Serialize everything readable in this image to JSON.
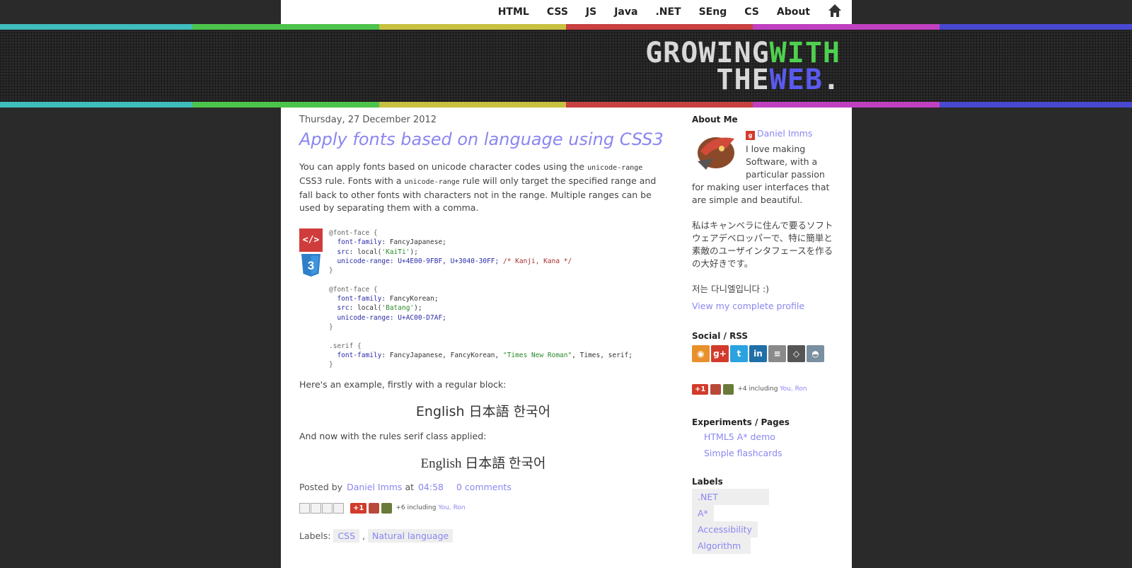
{
  "nav": {
    "items": [
      "HTML",
      "CSS",
      "JS",
      "Java",
      ".NET",
      "SEng",
      "CS",
      "About"
    ],
    "home_icon": "home-icon"
  },
  "stripe_colors": [
    "#3fbcbc",
    "#4cc44c",
    "#c8c040",
    "#c84040",
    "#c040c0",
    "#4848d0"
  ],
  "logo": {
    "line1": [
      "GROWING",
      "WITH"
    ],
    "line2": [
      "THE",
      "WEB",
      "."
    ]
  },
  "post": {
    "date": "Thursday, 27 December 2012",
    "title": "Apply fonts based on language using CSS3",
    "intro_1": "You can apply fonts based on unicode character codes using the ",
    "intro_code_1": "unicode-range",
    "intro_2": " CSS3 rule. Fonts with a ",
    "intro_code_2": "unicode-range",
    "intro_3": " rule will only target the specified range and fall back to other fonts with characters not in the range. Multiple ranges can be used by separating them with a comma.",
    "html_badge": "</>",
    "example_intro_1": "Here's an example, firstly with a regular block:",
    "example_text": "English 日本語 한국어",
    "example_intro_2": "And now with the rules serif class applied:",
    "posted_by_label": "Posted by",
    "author": "Daniel Imms",
    "at": "at",
    "time": "04:58",
    "comments": "0 comments",
    "plus_one": "+1",
    "plus_note_prefix": "+6 including ",
    "plus_note_names": "You, Ron",
    "labels_label": "Labels:",
    "labels": [
      "CSS",
      "Natural language"
    ]
  },
  "code": {
    "block1": [
      "@font-face {",
      "font-family",
      ": FancyJapanese;",
      "src",
      ": local(",
      "'KaiTi'",
      ");",
      "unicode-range",
      ": U+4E00-9FBF, U+3040-30FF;",
      "/* Kanji, Kana */",
      "}"
    ],
    "block2": [
      "@font-face {",
      "font-family",
      ": FancyKorean;",
      "src",
      ": local(",
      "'Batang'",
      ");",
      "unicode-range",
      ": U+AC00-D7AF;",
      "}"
    ],
    "block3": [
      ".serif {",
      "font-family",
      ": FancyJapanese, FancyKorean, ",
      "\"Times New Roman\"",
      ", Times, serif;",
      "}"
    ]
  },
  "sidebar": {
    "about_heading": "About Me",
    "author_link": "Daniel Imms",
    "about_text": "I love making Software, with a particular passion for making user interfaces that are simple and beautiful.",
    "japanese": "私はキャンベラに住んで要るソフトウェアデベロッパーで、特に簡単と素敵のユーザインタフェースを作るの大好きです。",
    "korean": "저는 다니엘입니다 :)",
    "profile_link": "View my complete profile",
    "social_heading": "Social / RSS",
    "social_icons": [
      {
        "name": "rss-icon",
        "glyph": "◉",
        "color": "#e8912c"
      },
      {
        "name": "google-plus-icon",
        "glyph": "g+",
        "color": "#d23b2c"
      },
      {
        "name": "twitter-icon",
        "glyph": "t",
        "color": "#2aa3e0"
      },
      {
        "name": "linkedin-icon",
        "glyph": "in",
        "color": "#1f6fa8"
      },
      {
        "name": "stackoverflow-icon",
        "glyph": "≡",
        "color": "#8a8a8a"
      },
      {
        "name": "codepen-icon",
        "glyph": "◇",
        "color": "#555555"
      },
      {
        "name": "github-icon",
        "glyph": "◓",
        "color": "#7a8fa0"
      }
    ],
    "plus_one": "+1",
    "plus_note_prefix": "+4 including ",
    "plus_note_names": "You, Ron",
    "experiments_heading": "Experiments / Pages",
    "experiments": [
      "HTML5 A* demo",
      "Simple flashcards"
    ],
    "labels_heading": "Labels",
    "labels": [
      ".NET",
      "A*",
      "Accessibility",
      "Algorithm"
    ]
  }
}
